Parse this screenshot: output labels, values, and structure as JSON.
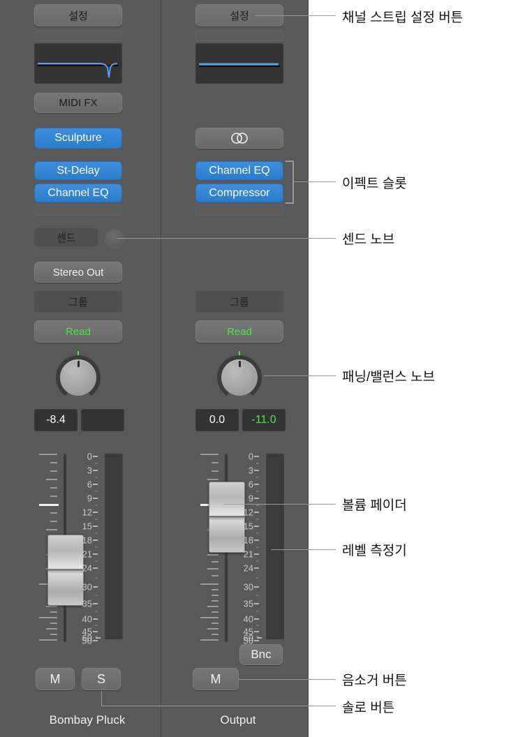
{
  "meta": {
    "app": "Logic Pro Mixer",
    "accent_blue": "#2f80d8",
    "green": "#4ae54a",
    "panel_bg": "#595959"
  },
  "channel_strips": [
    {
      "id": "bombay-pluck",
      "name": "Bombay Pluck",
      "settings_button": "설정",
      "eq_thumbnail": "eq-curve-notch",
      "midi_fx_label": "MIDI FX",
      "instrument": "Sculpture",
      "audio_fx": [
        "St-Delay",
        "Channel EQ"
      ],
      "sends_label": "센드",
      "send_knob": "send-knob",
      "output": "Stereo Out",
      "group_label": "그룹",
      "automation_mode": "Read",
      "pan_value": "",
      "volume_value": "-8.4",
      "peak_value": "",
      "mute_label": "M",
      "solo_label": "S",
      "bounce_label": ""
    },
    {
      "id": "output",
      "name": "Output",
      "settings_button": "설정",
      "eq_thumbnail": "eq-curve-flat",
      "midi_fx_label": "",
      "instrument_icon": "stereo-circles-icon",
      "audio_fx": [
        "Channel EQ",
        "Compressor"
      ],
      "sends_label": "",
      "output": "",
      "group_label": "그룹",
      "automation_mode": "Read",
      "volume_value": "0.0",
      "peak_value": "-11.0",
      "mute_label": "M",
      "solo_label": "",
      "bounce_label": "Bnc"
    }
  ],
  "fader_scale_labels": [
    "0",
    "3",
    "6",
    "9",
    "12",
    "15",
    "18",
    "21",
    "24",
    "30",
    "35",
    "40",
    "45",
    "50",
    "60"
  ],
  "callouts": [
    {
      "id": "channel-strip-settings",
      "text": "채널 스트립 설정 버튼"
    },
    {
      "id": "effect-slot",
      "text": "이펙트 슬롯"
    },
    {
      "id": "send-knob",
      "text": "센드 노브"
    },
    {
      "id": "pan-balance-knob",
      "text": "패닝/밸런스 노브"
    },
    {
      "id": "volume-fader",
      "text": "볼륨 페이더"
    },
    {
      "id": "level-meter",
      "text": "레벨 측정기"
    },
    {
      "id": "mute-button",
      "text": "음소거 버튼"
    },
    {
      "id": "solo-button",
      "text": "솔로 버튼"
    }
  ]
}
